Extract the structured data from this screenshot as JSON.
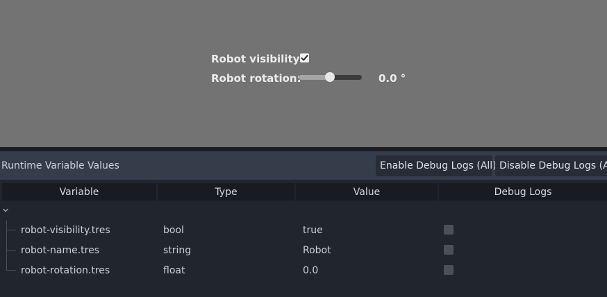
{
  "preview": {
    "visibility_label": "Robot visibility:",
    "visibility_checked": true,
    "rotation_label": "Robot rotation:",
    "rotation_slider_fraction": 0.5,
    "rotation_value": "0.0 °"
  },
  "panel": {
    "title": "Runtime Variable Values",
    "enable_button": "Enable Debug Logs (All)",
    "disable_button": "Disable Debug Logs (All)",
    "columns": {
      "variable": "Variable",
      "type": "Type",
      "value": "Value",
      "debug": "Debug Logs"
    },
    "rows": [
      {
        "name": "robot-visibility.tres",
        "type": "bool",
        "value": "true",
        "debug_enabled": false
      },
      {
        "name": "robot-name.tres",
        "type": "string",
        "value": "Robot",
        "debug_enabled": false
      },
      {
        "name": "robot-rotation.tres",
        "type": "float",
        "value": "0.0",
        "debug_enabled": false
      }
    ]
  }
}
